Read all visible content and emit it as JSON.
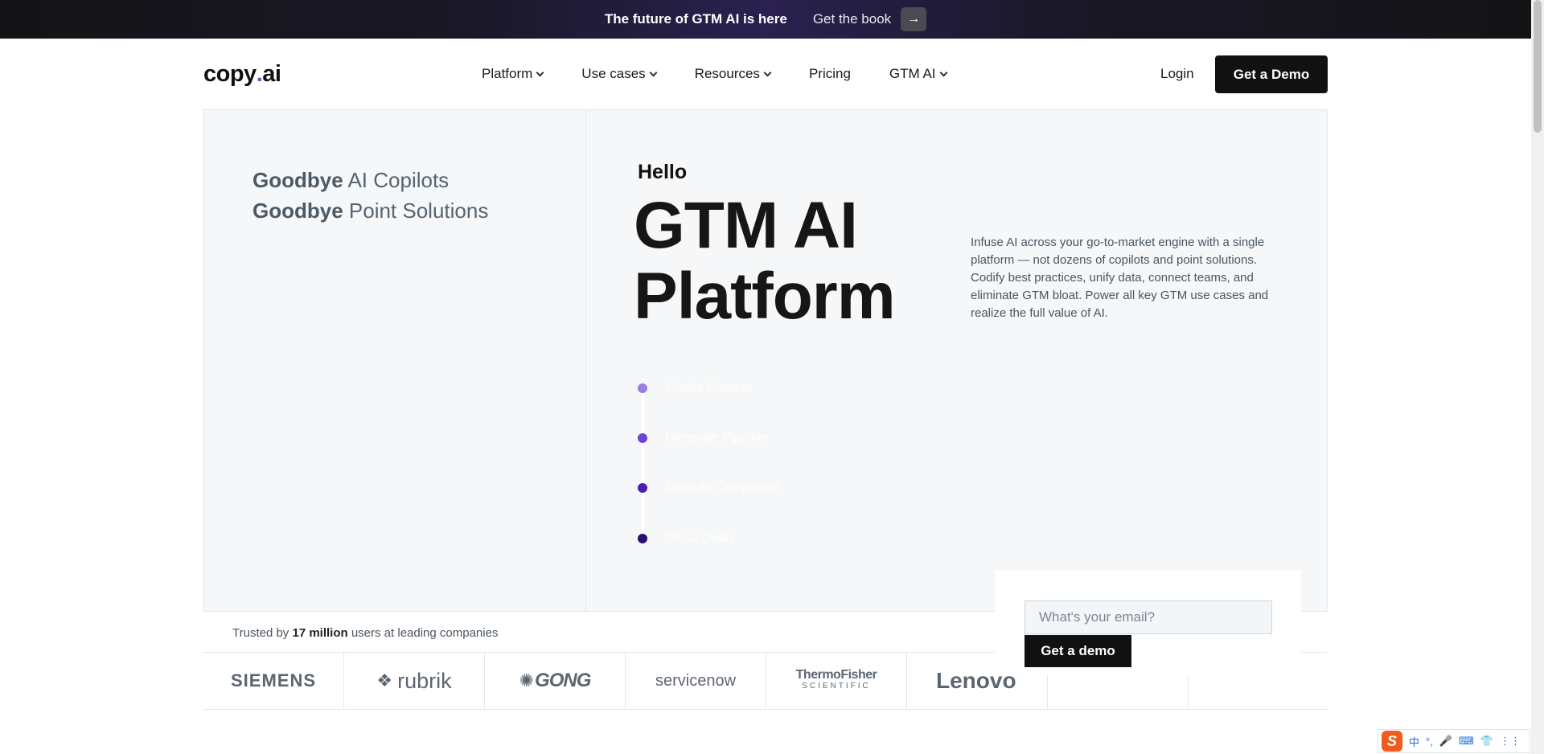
{
  "announcement": {
    "title": "The future of GTM AI is here",
    "link_label": "Get the book",
    "arrow": "→"
  },
  "header": {
    "logo_text": "copy",
    "logo_dot": ".",
    "logo_suffix": "ai",
    "nav": [
      {
        "label": "Platform",
        "has_dropdown": true
      },
      {
        "label": "Use cases",
        "has_dropdown": true
      },
      {
        "label": "Resources",
        "has_dropdown": true
      },
      {
        "label": "Pricing",
        "has_dropdown": false
      },
      {
        "label": "GTM AI",
        "has_dropdown": true
      }
    ],
    "login_label": "Login",
    "cta_label": "Get a Demo"
  },
  "hero": {
    "goodbye_lines": [
      {
        "bold": "Goodbye",
        "rest": " AI Copilots"
      },
      {
        "bold": "Goodbye",
        "rest": " Point Solutions"
      }
    ],
    "hello": "Hello",
    "headline_line1": "GTM AI",
    "headline_line2": "Platform",
    "description": "Infuse AI across your go-to-market engine with a single platform — not dozens of copilots and point solutions. Codify best practices, unify data, connect teams, and eliminate GTM bloat. Power all key GTM use cases and realize the full value of AI.",
    "timeline": [
      {
        "label": "Create Content",
        "color": "#9b7fe0"
      },
      {
        "label": "Generate Pipeline",
        "color": "#6c45d6"
      },
      {
        "label": "Execute Campaigns",
        "color": "#4a1fb0"
      },
      {
        "label": "Close Deals",
        "color": "#2a0f6e"
      }
    ]
  },
  "trusted": {
    "prefix": "Trusted by ",
    "count": "17 million",
    "suffix": " users at leading companies",
    "logos": [
      "SIEMENS",
      "rubrik",
      "GONG",
      "servicenow",
      "ThermoFisher",
      "SCIENTIFIC",
      "Lenovo"
    ]
  },
  "email_capture": {
    "placeholder": "What's your email?",
    "button_label": "Get a demo"
  },
  "ime": {
    "logo": "S",
    "items": [
      "中",
      "°,",
      "🎤",
      "⌨",
      "👕",
      "⋮⋮"
    ]
  }
}
